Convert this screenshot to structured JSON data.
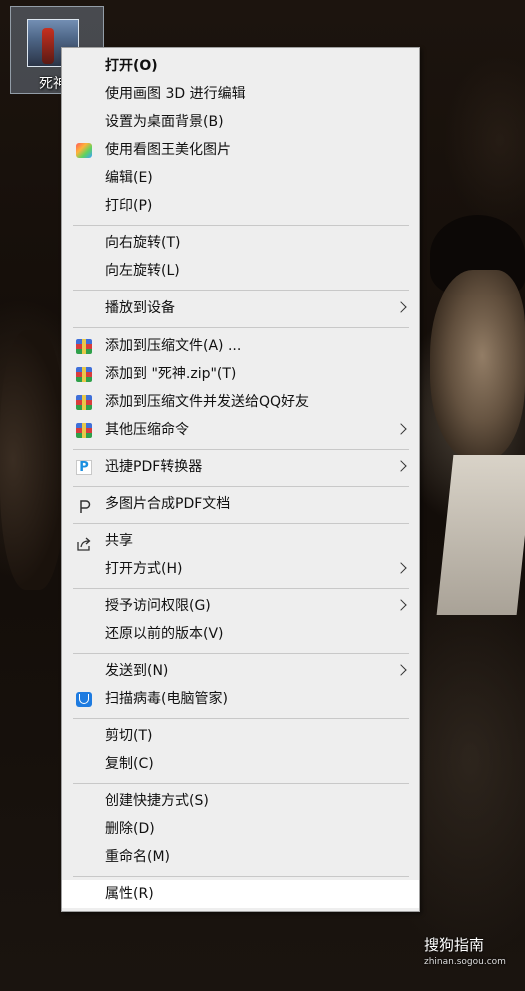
{
  "desktop": {
    "file_label": "死神",
    "watermark": "搜狗指南",
    "watermark_url": "zhinan.sogou.com"
  },
  "menu": {
    "items": [
      {
        "label": "打开(O)"
      },
      {
        "label": "使用画图 3D 进行编辑"
      },
      {
        "label": "设置为桌面背景(B)"
      },
      {
        "label": "使用看图王美化图片",
        "icon": "kantu-icon"
      },
      {
        "label": "编辑(E)"
      },
      {
        "label": "打印(P)"
      },
      {
        "label": "向右旋转(T)"
      },
      {
        "label": "向左旋转(L)"
      },
      {
        "label": "播放到设备",
        "submenu": true
      },
      {
        "label": "添加到压缩文件(A) ...",
        "icon": "winrar-icon"
      },
      {
        "label": "添加到 \"死神.zip\"(T)",
        "icon": "winrar-icon"
      },
      {
        "label": "添加到压缩文件并发送给QQ好友",
        "icon": "winrar-icon"
      },
      {
        "label": "其他压缩命令",
        "icon": "winrar-icon",
        "submenu": true
      },
      {
        "label": "迅捷PDF转换器",
        "icon": "pdf-converter-icon",
        "submenu": true
      },
      {
        "label": "多图片合成PDF文档",
        "icon": "pdf-merge-icon"
      },
      {
        "label": "共享",
        "icon": "share-icon"
      },
      {
        "label": "打开方式(H)",
        "submenu": true
      },
      {
        "label": "授予访问权限(G)",
        "submenu": true
      },
      {
        "label": "还原以前的版本(V)"
      },
      {
        "label": "发送到(N)",
        "submenu": true
      },
      {
        "label": "扫描病毒(电脑管家)",
        "icon": "shield-icon"
      },
      {
        "label": "剪切(T)"
      },
      {
        "label": "复制(C)"
      },
      {
        "label": "创建快捷方式(S)"
      },
      {
        "label": "删除(D)"
      },
      {
        "label": "重命名(M)"
      },
      {
        "label": "属性(R)"
      }
    ]
  }
}
